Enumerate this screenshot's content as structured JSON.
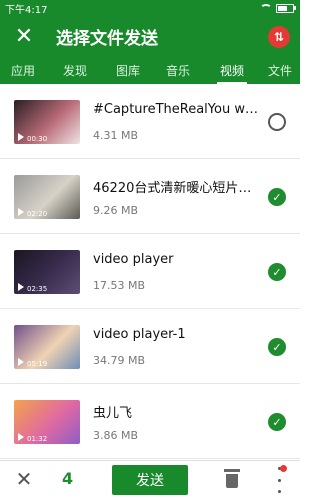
{
  "status_bar": {
    "time": "下午4:17",
    "battery_level": 0.65
  },
  "header": {
    "title": "选择文件发送",
    "close_icon": "close-icon",
    "sort_icon": "sort-icon"
  },
  "tabs": [
    {
      "label": "应用"
    },
    {
      "label": "发现"
    },
    {
      "label": "图库"
    },
    {
      "label": "音乐"
    },
    {
      "label": "视频",
      "active": true
    },
    {
      "label": "文件"
    }
  ],
  "items": [
    {
      "name": "#CaptureTheRealYou with...",
      "size": "4.31 MB",
      "duration": "00:30",
      "selected": false,
      "thumb_colors": [
        "#2b1f25",
        "#b86b77",
        "#efe3e4"
      ]
    },
    {
      "name": "46220台式清新暖心短片《...",
      "size": "9.26 MB",
      "duration": "02:20",
      "selected": true,
      "thumb_colors": [
        "#9b9b9b",
        "#d7d1c7",
        "#5a5b53"
      ]
    },
    {
      "name": "video player",
      "size": "17.53 MB",
      "duration": "02:35",
      "selected": true,
      "thumb_colors": [
        "#1a1622",
        "#3a2d4f",
        "#5e4e74"
      ]
    },
    {
      "name": "video player-1",
      "size": "34.79 MB",
      "duration": "05:19",
      "selected": true,
      "thumb_colors": [
        "#70518a",
        "#f0d2b3",
        "#6d8fb6"
      ]
    },
    {
      "name": "虫儿飞",
      "size": "3.86 MB",
      "duration": "01:32",
      "selected": true,
      "thumb_colors": [
        "#f3a24b",
        "#e06aa0",
        "#8f5ec5"
      ]
    }
  ],
  "bottom_bar": {
    "selected_count": "4",
    "send_label": "发送"
  }
}
